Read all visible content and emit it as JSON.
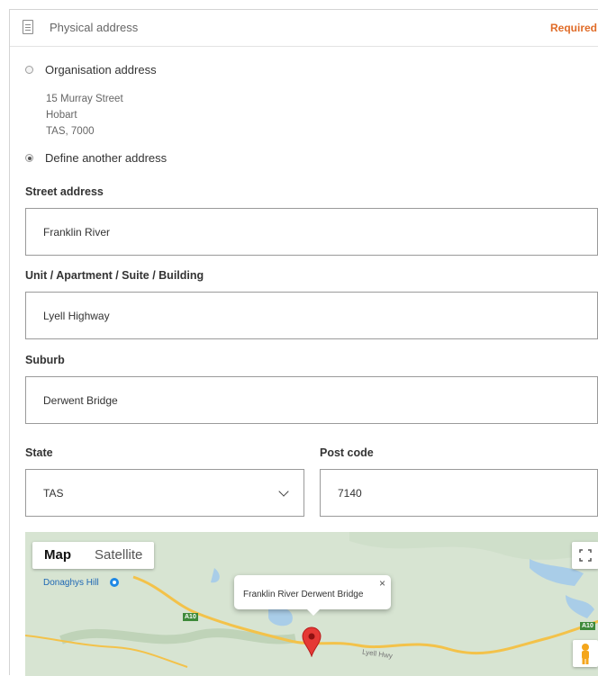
{
  "section": {
    "title": "Physical address",
    "required_label": "Required"
  },
  "address_options": {
    "organisation": {
      "label": "Organisation address",
      "lines": [
        "15 Murray Street",
        "Hobart",
        "TAS, 7000"
      ],
      "selected": false
    },
    "other": {
      "label": "Define another address",
      "selected": true
    }
  },
  "fields": {
    "street": {
      "label": "Street address",
      "value": "Franklin River"
    },
    "unit": {
      "label": "Unit / Apartment / Suite / Building",
      "value": "Lyell Highway"
    },
    "suburb": {
      "label": "Suburb",
      "value": "Derwent Bridge"
    },
    "state": {
      "label": "State",
      "value": "TAS"
    },
    "postcode": {
      "label": "Post code",
      "value": "7140"
    }
  },
  "map": {
    "tabs": [
      "Map",
      "Satellite"
    ],
    "active_tab": "Map",
    "place_labels": [
      "Donaghys Hill"
    ],
    "road_signs": [
      "A10",
      "A10"
    ],
    "road_name": "Lyell Hwy",
    "info_window_text": "Franklin River Derwent Bridge",
    "close_symbol": "×",
    "icons": [
      "fullscreen-icon",
      "pegman-icon",
      "map-marker-icon",
      "close-icon"
    ],
    "colors": {
      "land": "#d7e4d2",
      "road": "#f3c24a",
      "water": "#a9cde8",
      "marker": "#e53935"
    }
  }
}
